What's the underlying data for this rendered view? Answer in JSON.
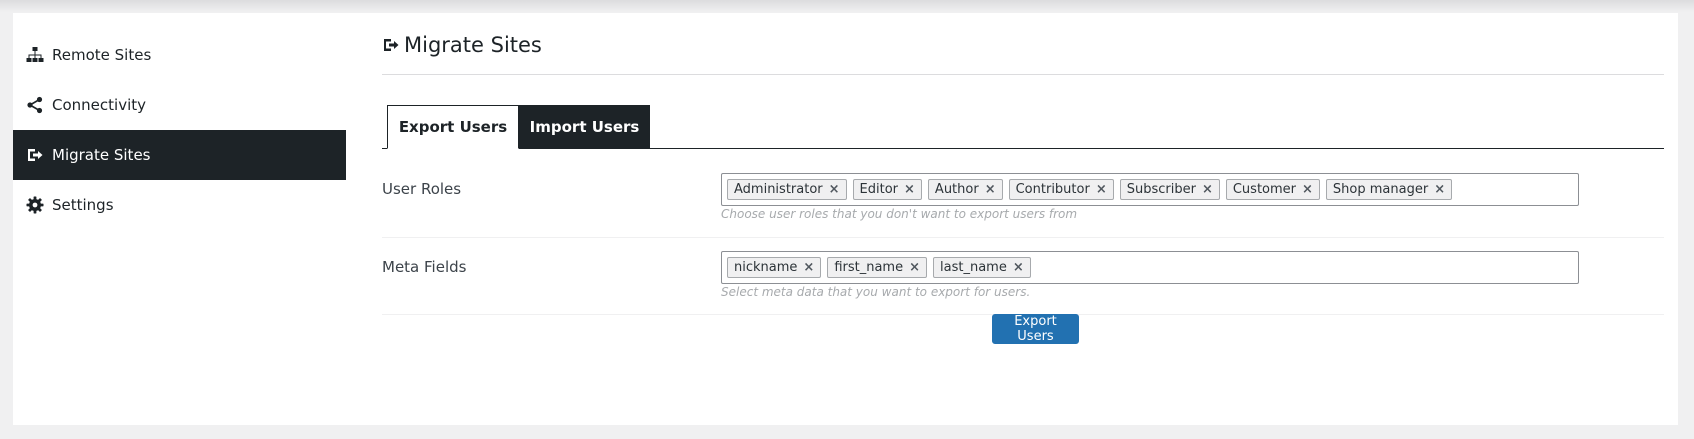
{
  "sidebar": {
    "items": [
      {
        "label": "Remote Sites",
        "icon": "sitemap-icon",
        "active": false
      },
      {
        "label": "Connectivity",
        "icon": "share-icon",
        "active": false
      },
      {
        "label": "Migrate Sites",
        "icon": "migrate-icon",
        "active": true
      },
      {
        "label": "Settings",
        "icon": "gear-icon",
        "active": false
      }
    ]
  },
  "main": {
    "title": "Migrate Sites",
    "title_icon": "migrate-icon",
    "tabs": [
      {
        "label": "Export Users",
        "active": true
      },
      {
        "label": "Import Users",
        "active": false
      }
    ],
    "user_roles": {
      "label": "User Roles",
      "tags": [
        "Administrator",
        "Editor",
        "Author",
        "Contributor",
        "Subscriber",
        "Customer",
        "Shop manager"
      ],
      "hint": "Choose user roles that you don't want to export users from"
    },
    "meta_fields": {
      "label": "Meta Fields",
      "tags": [
        "nickname",
        "first_name",
        "last_name"
      ],
      "hint": "Select meta data that you want to export for users."
    },
    "export_button": "Export Users",
    "remove_symbol": "×"
  },
  "colors": {
    "accent": "#2271b1",
    "dark": "#1d2327",
    "background": "#f0f0f1"
  }
}
